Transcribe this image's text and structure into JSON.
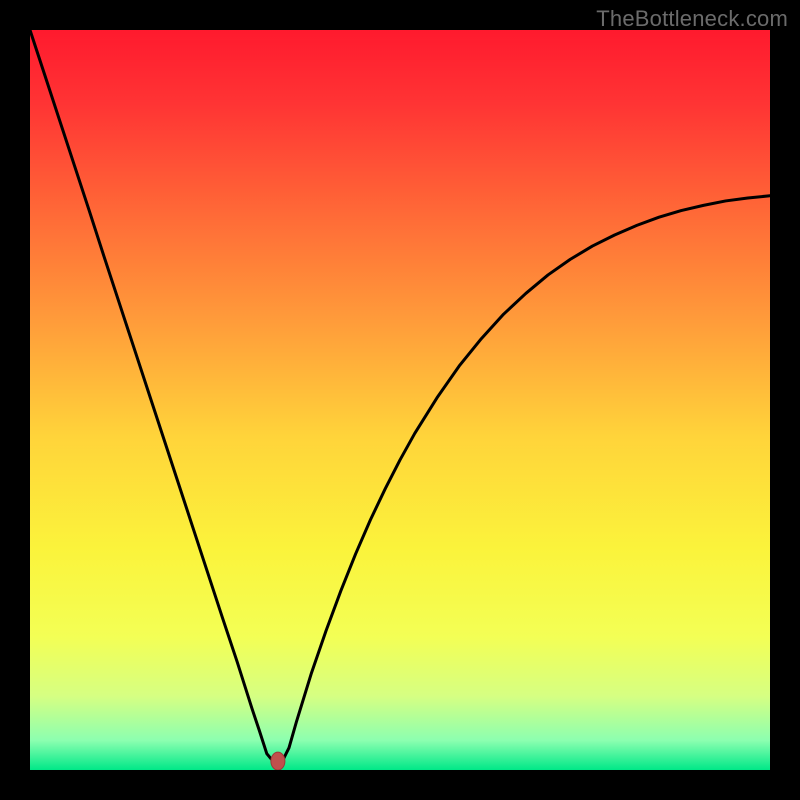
{
  "watermark": "TheBottleneck.com",
  "chart_data": {
    "type": "line",
    "title": "",
    "xlabel": "",
    "ylabel": "",
    "xlim": [
      0,
      100
    ],
    "ylim": [
      0,
      100
    ],
    "x": [
      0,
      2,
      4,
      6,
      8,
      10,
      12,
      14,
      16,
      18,
      20,
      22,
      24,
      26,
      28,
      30,
      31,
      32,
      33,
      34,
      35,
      36,
      38,
      40,
      42,
      44,
      46,
      48,
      50,
      52,
      55,
      58,
      61,
      64,
      67,
      70,
      73,
      76,
      79,
      82,
      85,
      88,
      91,
      94,
      97,
      100
    ],
    "values": [
      100,
      93.9,
      87.8,
      81.7,
      75.6,
      69.4,
      63.3,
      57.2,
      51.1,
      45.0,
      38.9,
      32.8,
      26.7,
      20.6,
      14.6,
      8.3,
      5.3,
      2.2,
      1.0,
      1.0,
      3.0,
      6.5,
      13.0,
      18.8,
      24.2,
      29.2,
      33.8,
      38.0,
      41.9,
      45.5,
      50.3,
      54.6,
      58.3,
      61.6,
      64.4,
      66.9,
      69.0,
      70.8,
      72.3,
      73.6,
      74.7,
      75.6,
      76.3,
      76.9,
      77.3,
      77.6
    ],
    "marker": {
      "x": 33.5,
      "y": 1.2
    },
    "gradient_stops": [
      {
        "offset": 0.0,
        "color": "#ff1a2e"
      },
      {
        "offset": 0.1,
        "color": "#ff3434"
      },
      {
        "offset": 0.25,
        "color": "#ff6a37"
      },
      {
        "offset": 0.4,
        "color": "#ff9e3a"
      },
      {
        "offset": 0.55,
        "color": "#ffd43a"
      },
      {
        "offset": 0.7,
        "color": "#fbf33b"
      },
      {
        "offset": 0.82,
        "color": "#f3ff55"
      },
      {
        "offset": 0.9,
        "color": "#d6ff82"
      },
      {
        "offset": 0.96,
        "color": "#8cffb0"
      },
      {
        "offset": 1.0,
        "color": "#00e888"
      }
    ],
    "curve_color": "#000000",
    "curve_width": 3,
    "marker_color": "#c0504d",
    "marker_rx": 7,
    "marker_ry": 9
  }
}
